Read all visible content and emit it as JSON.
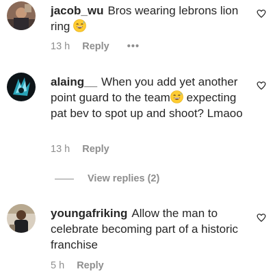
{
  "comments": [
    {
      "username": "jacob_wu",
      "text_before": "Bros wearing lebrons lion ring",
      "text_after": "",
      "emoji": "grinning-sweat-emoji",
      "time": "13 h",
      "reply_label": "Reply",
      "more_label": "•••"
    },
    {
      "username": "alaing__",
      "text_before": "When you add yet another point guard to the team",
      "text_after": "expecting pat bev to spot up and shoot? Lmaoo",
      "emoji": "grinning-sweat-emoji",
      "time": "13 h",
      "reply_label": "Reply",
      "view_replies_label": "View replies (2)"
    },
    {
      "username": "youngafriking",
      "text_before": "Allow the man to celebrate becoming part of a historic franchise",
      "text_after": "",
      "time": "5 h",
      "reply_label": "Reply"
    }
  ],
  "icons": {
    "like": "heart-outline-icon",
    "emoji": "grinning-face-with-sweat-icon"
  },
  "colors": {
    "text": "#262626",
    "muted": "#8e8e8e",
    "background": "#ffffff"
  }
}
